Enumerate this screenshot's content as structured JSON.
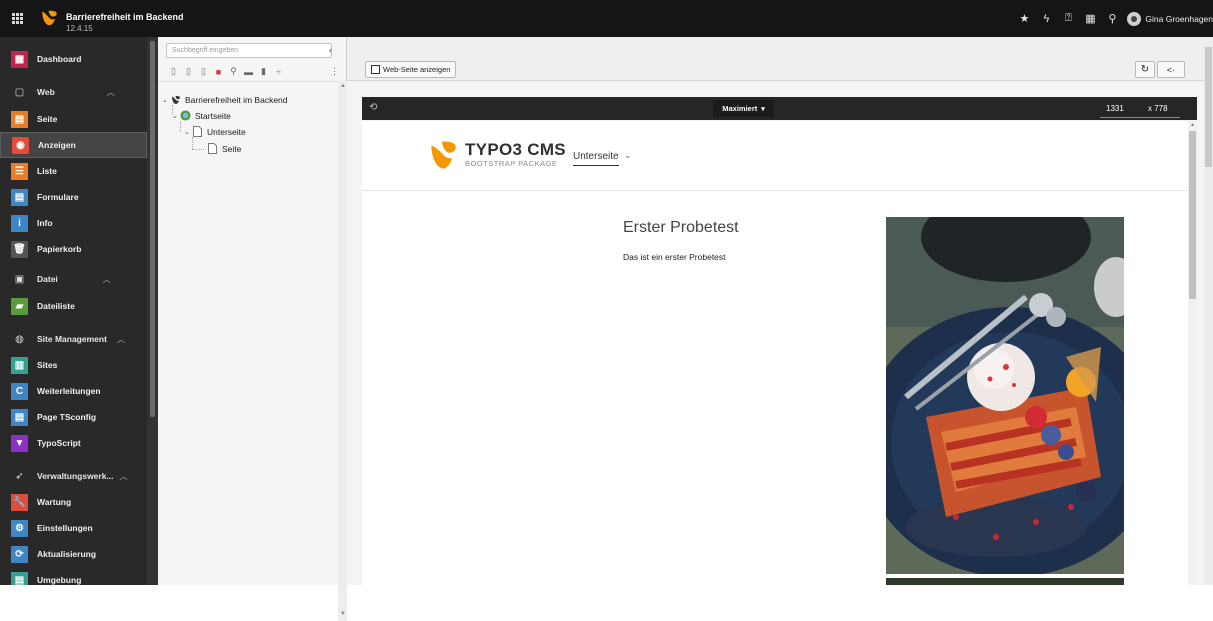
{
  "topbar": {
    "site_name": "Barrierefreiheit im Backend",
    "version": "12.4.15",
    "icons": [
      "bookmark-star-icon",
      "flash-icon",
      "help-icon",
      "system-info-icon",
      "search-icon"
    ],
    "username": "Gina Groenhagen"
  },
  "modules": {
    "dashboard": "Dashboard",
    "web_group": "Web",
    "seite": "Seite",
    "anzeigen": "Anzeigen",
    "liste": "Liste",
    "formulare": "Formulare",
    "info": "Info",
    "papierkorb": "Papierkorb",
    "datei_group": "Datei",
    "dateiliste": "Dateiliste",
    "site_group": "Site Management",
    "sites": "Sites",
    "weiterleitungen": "Weiterleitungen",
    "page_tsconfig": "Page TSconfig",
    "typoscript": "TypoScript",
    "verwaltung_group": "Verwaltungswerk...",
    "wartung": "Wartung",
    "einstellungen": "Einstellungen",
    "aktualisierung": "Aktualisierung",
    "umgebung": "Umgebung",
    "colors": {
      "dashboard": "#c0254d",
      "seite": "#ea7d27",
      "anzeigen": "#e44b3a",
      "liste": "#ea7d27",
      "formulare": "#3f86c5",
      "info": "#3f86c5",
      "papierkorb": "#555555",
      "dateiliste": "#5b9b3b",
      "sites": "#36a18f",
      "weiterleitungen": "#3f86c5",
      "page_tsconfig": "#3f86c5",
      "typoscript": "#8a31c7",
      "wartung": "#e44b3a",
      "einstellungen": "#3f86c5",
      "aktualisierung": "#3f86c5",
      "umgebung": "#36a18f"
    }
  },
  "pagetree": {
    "search_placeholder": "Suchbegriff eingeben",
    "root": "Barrierefreiheit im Backend",
    "startseite": "Startseite",
    "unterseite": "Unterseite",
    "seite": "Seite"
  },
  "docheader": {
    "view_button": "Web-Seite anzeigen"
  },
  "viewbar": {
    "mode": "Maximiert",
    "width": "1331",
    "height": "x 778"
  },
  "preview": {
    "brand": "TYPO3 CMS",
    "brand_sub": "BOOTSTRAP PACKAGE",
    "nav_item": "Unterseite",
    "heading": "Erster Probetest",
    "paragraph": "Das ist ein erster Probetest"
  }
}
